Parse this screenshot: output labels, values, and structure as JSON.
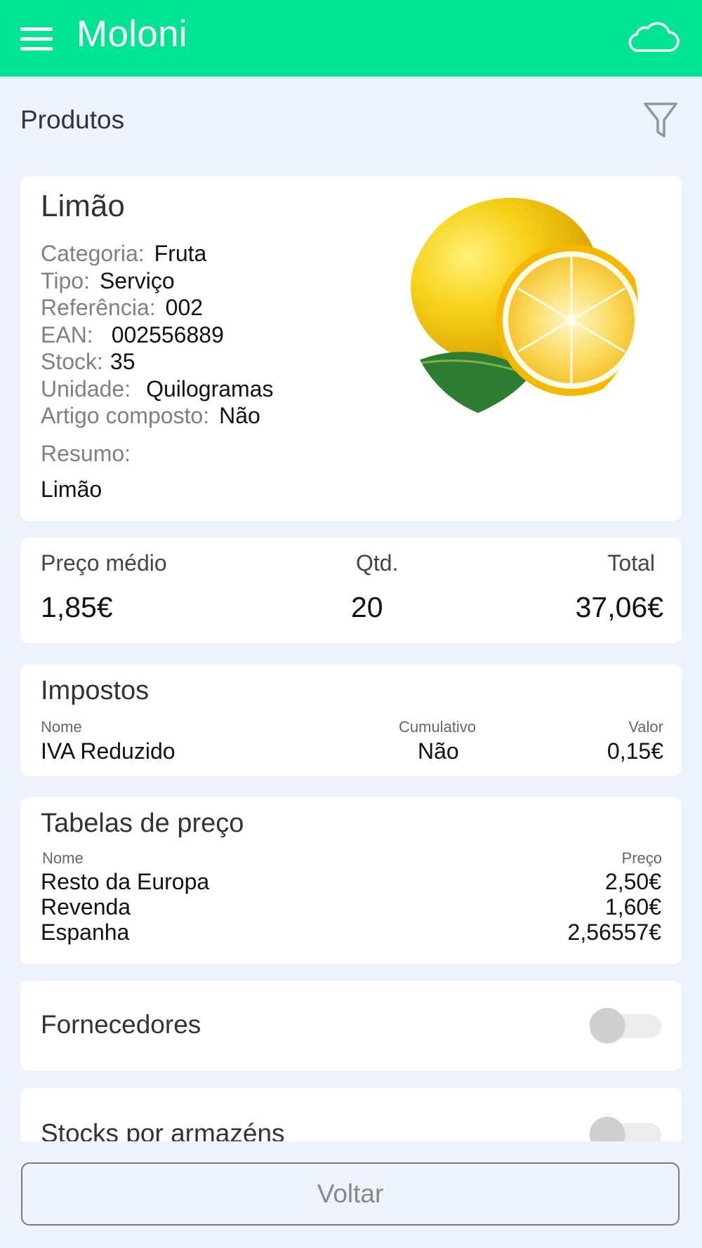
{
  "header": {
    "title": "Moloni",
    "menu_icon": "hamburger-menu-icon",
    "cloud_icon": "cloud-icon"
  },
  "page": {
    "title": "Produtos",
    "filter_icon": "filter-icon"
  },
  "product": {
    "name": "Limão",
    "attributes": [
      {
        "label": "Categoria:",
        "value": "Fruta"
      },
      {
        "label": "Tipo:",
        "value": "Serviço"
      },
      {
        "label": "Referência:",
        "value": "002"
      },
      {
        "label": "EAN:",
        "value": "002556889"
      },
      {
        "label": "Stock:",
        "value": "35"
      },
      {
        "label": "Unidade:",
        "value": "Quilogramas"
      },
      {
        "label": "Artigo composto:",
        "value": "Não"
      }
    ],
    "summary_label": "Resumo:",
    "summary_value": "Limão",
    "image": "lemon-image"
  },
  "pricing": {
    "avg_label": "Preço médio",
    "avg_value": "1,85€",
    "qty_label": "Qtd.",
    "qty_value": "20",
    "total_label": "Total",
    "total_value": "37,06€"
  },
  "taxes": {
    "title": "Impostos",
    "col_name": "Nome",
    "col_cumulative": "Cumulativo",
    "col_value": "Valor",
    "row": {
      "name": "IVA Reduzido",
      "cumulative": "Não",
      "value": "0,15€"
    }
  },
  "price_tables": {
    "title": "Tabelas de preço",
    "col_name": "Nome",
    "col_price": "Preço",
    "rows": [
      {
        "name": "Resto da Europa",
        "price": "2,50€"
      },
      {
        "name": "Revenda",
        "price": "1,60€"
      },
      {
        "name": "Espanha",
        "price": "2,56557€"
      }
    ]
  },
  "suppliers": {
    "title": "Fornecedores",
    "enabled": false
  },
  "stocks": {
    "title": "Stocks por armazéns",
    "enabled": false
  },
  "footer": {
    "back_label": "Voltar"
  },
  "colors": {
    "header": "#00e392",
    "background": "#eef2fb",
    "card": "#ffffff"
  }
}
